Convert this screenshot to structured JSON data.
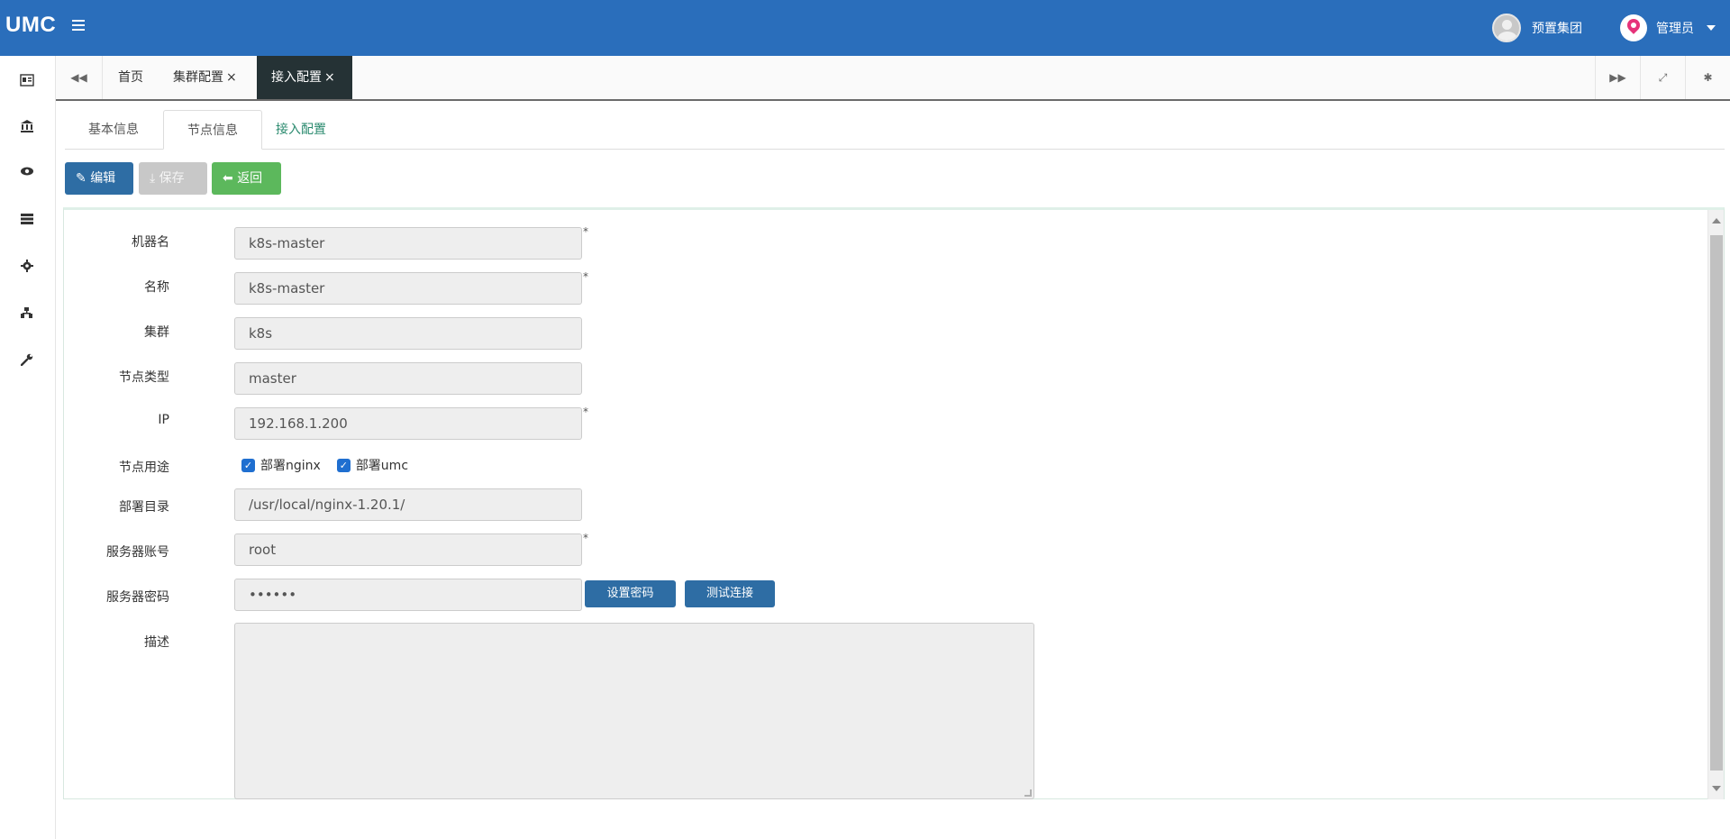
{
  "app": {
    "logo": "UMC"
  },
  "header": {
    "org_name": "预置集团",
    "user_name": "管理员"
  },
  "tabs": [
    {
      "label": "首页",
      "closable": false
    },
    {
      "label": "集群配置",
      "closable": true
    },
    {
      "label": "接入配置",
      "closable": true,
      "active": true
    }
  ],
  "tab_close_glyph": "×",
  "subtabs": [
    "基本信息",
    "节点信息",
    "接入配置"
  ],
  "toolbar": {
    "edit_label": "编辑",
    "save_label": "保存",
    "back_label": "返回"
  },
  "form": {
    "machine_name": {
      "label": "机器名",
      "value": "k8s-master",
      "required": true
    },
    "name": {
      "label": "名称",
      "value": "k8s-master",
      "required": true
    },
    "cluster": {
      "label": "集群",
      "value": "k8s"
    },
    "node_type": {
      "label": "节点类型",
      "value": "master"
    },
    "ip": {
      "label": "IP",
      "value": "192.168.1.200",
      "required": true
    },
    "usage": {
      "label": "节点用途",
      "options": [
        {
          "label": "部署nginx",
          "checked": true
        },
        {
          "label": "部署umc",
          "checked": true
        }
      ]
    },
    "deploy_dir": {
      "label": "部署目录",
      "value": "/usr/local/nginx-1.20.1/"
    },
    "server_account": {
      "label": "服务器账号",
      "value": "root",
      "required": true
    },
    "server_password": {
      "label": "服务器密码",
      "value": "••••••"
    },
    "set_password_label": "设置密码",
    "test_connection_label": "测试连接",
    "description": {
      "label": "描述",
      "value": ""
    },
    "required_mark": "*"
  },
  "colors": {
    "topbar": "#2a6ebb",
    "active_tab": "#253235",
    "edit_btn": "#2e6da4",
    "back_btn": "#5cb85c",
    "checkbox": "#1f6fd0"
  }
}
